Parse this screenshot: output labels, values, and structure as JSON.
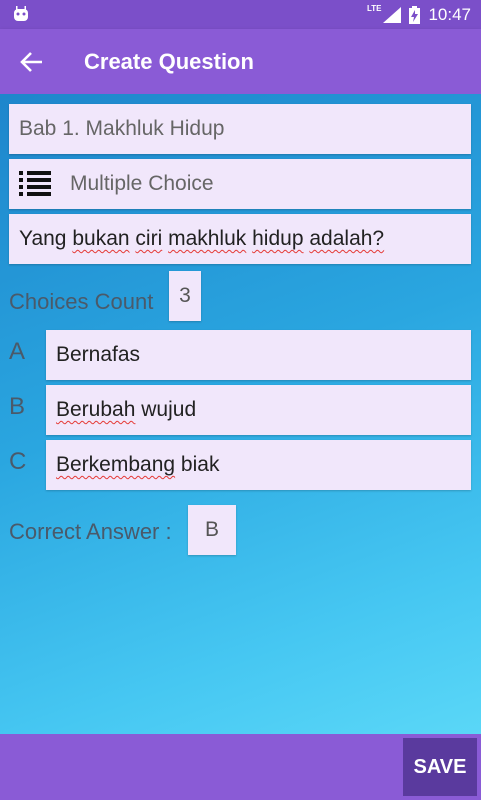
{
  "status": {
    "network": "LTE",
    "time": "10:47"
  },
  "appbar": {
    "title": "Create Question"
  },
  "form": {
    "chapter": "Bab 1. Makhluk Hidup",
    "question_type": "Multiple Choice",
    "question_words": [
      "Yang",
      "bukan",
      "ciri",
      "makhluk",
      "hidup",
      "adalah?"
    ],
    "choices_count_label": "Choices Count",
    "choices_count": "3",
    "choices": [
      {
        "letter": "A",
        "words": [
          "Bernafas"
        ]
      },
      {
        "letter": "B",
        "words": [
          "Berubah",
          "wujud"
        ]
      },
      {
        "letter": "C",
        "words": [
          "Berkembang",
          "biak"
        ]
      }
    ],
    "correct_answer_label": "Correct Answer :",
    "correct_answer": "B"
  },
  "bottombar": {
    "save_label": "SAVE"
  },
  "colors": {
    "primary": "#8a5bd6",
    "status_bar": "#7b4fc9",
    "save_button": "#5a3a9e",
    "field_bg": "#f1e7fb",
    "spell_underline": "#e53935"
  }
}
